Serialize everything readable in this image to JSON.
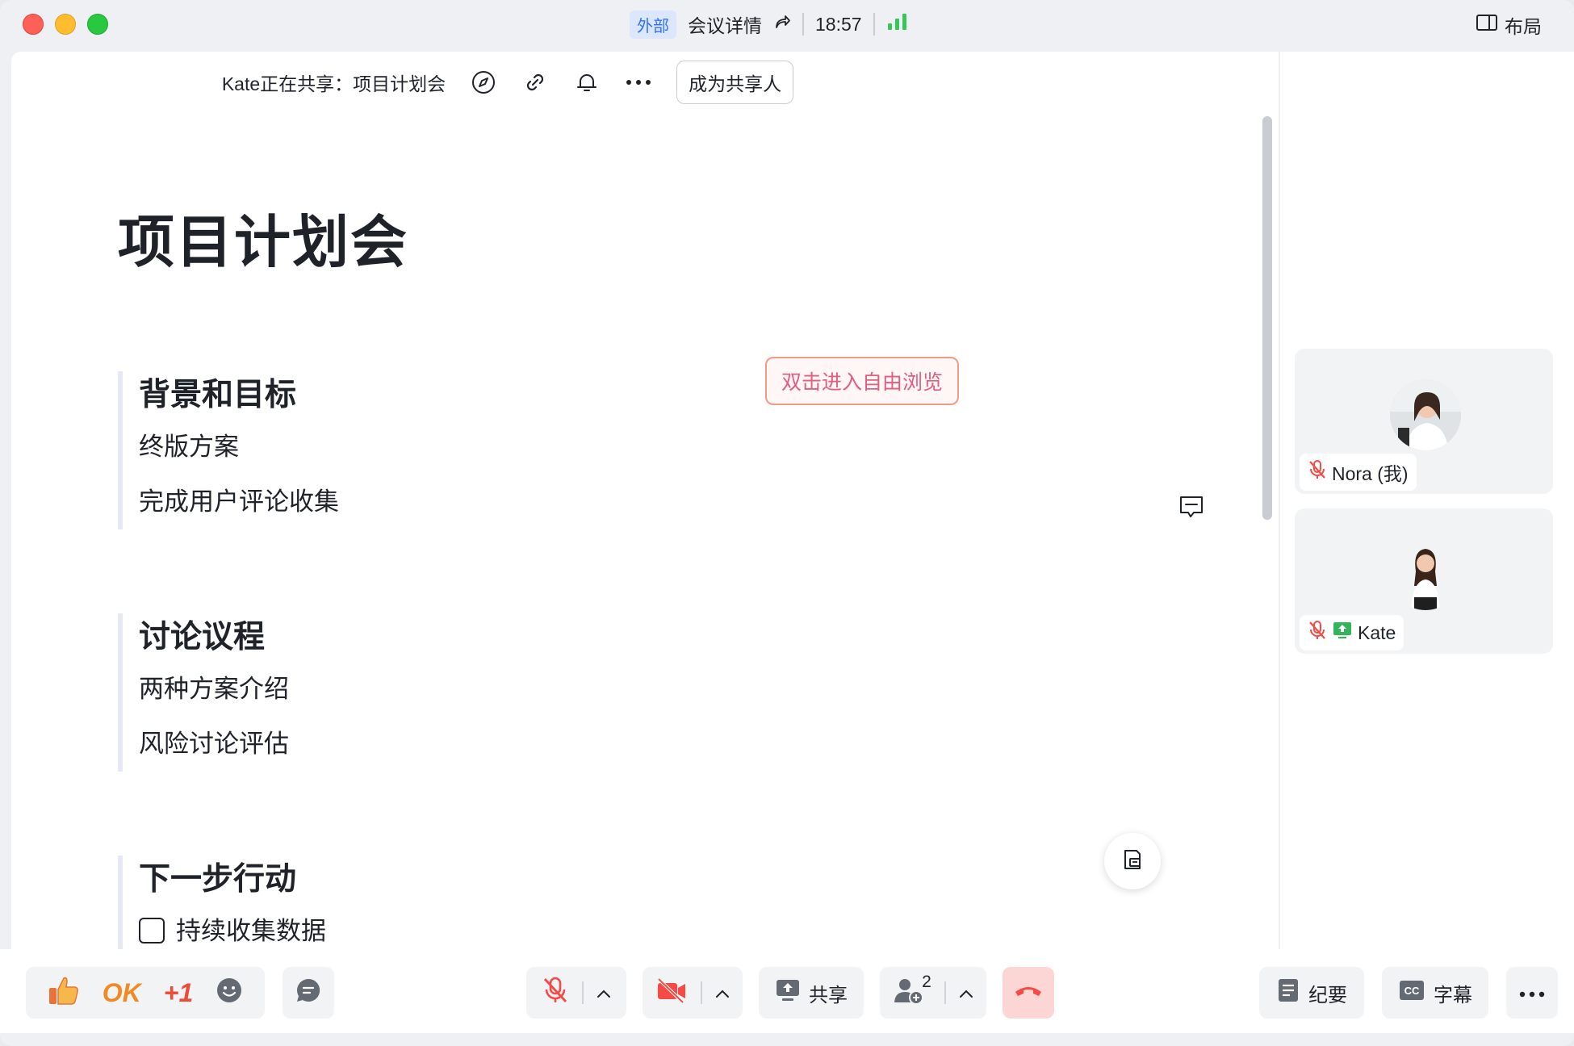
{
  "titlebar": {
    "badge": "外部",
    "meeting_details": "会议详情",
    "time": "18:57",
    "layout_label": "布局"
  },
  "share_bar": {
    "sharing_text": "Kate正在共享：项目计划会",
    "become_sharer": "成为共享人"
  },
  "document": {
    "title": "项目计划会",
    "sections": [
      {
        "heading": "背景和目标",
        "items": [
          "终版方案",
          "完成用户评论收集"
        ]
      },
      {
        "heading": "讨论议程",
        "items": [
          "两种方案介绍",
          "风险讨论评估"
        ]
      },
      {
        "heading": "下一步行动",
        "items": [
          "持续收集数据"
        ]
      }
    ],
    "free_browse_hint": "双击进入自由浏览"
  },
  "participants": [
    {
      "name": "Nora (我)",
      "muted": true,
      "sharing": false
    },
    {
      "name": "Kate",
      "muted": true,
      "sharing": true
    }
  ],
  "toolbar": {
    "reaction_ok": "OK",
    "reaction_plus1": "+1",
    "share_label": "共享",
    "participants_count": "2",
    "minutes_label": "纪要",
    "captions_label": "字幕"
  },
  "colors": {
    "accent": "#3370ff",
    "danger": "#f54a45",
    "signal": "#34c759",
    "share_green": "#34b45a"
  },
  "icons": [
    "compass-icon",
    "link-icon",
    "bell-icon",
    "more-icon",
    "comment-icon",
    "document-float-icon",
    "thumbs-up-icon",
    "emoji-icon",
    "chat-icon",
    "mic-muted-icon",
    "camera-off-icon",
    "share-screen-icon",
    "add-participant-icon",
    "hang-up-icon",
    "minutes-icon",
    "captions-icon",
    "layout-icon",
    "signal-icon",
    "share-link-icon"
  ]
}
